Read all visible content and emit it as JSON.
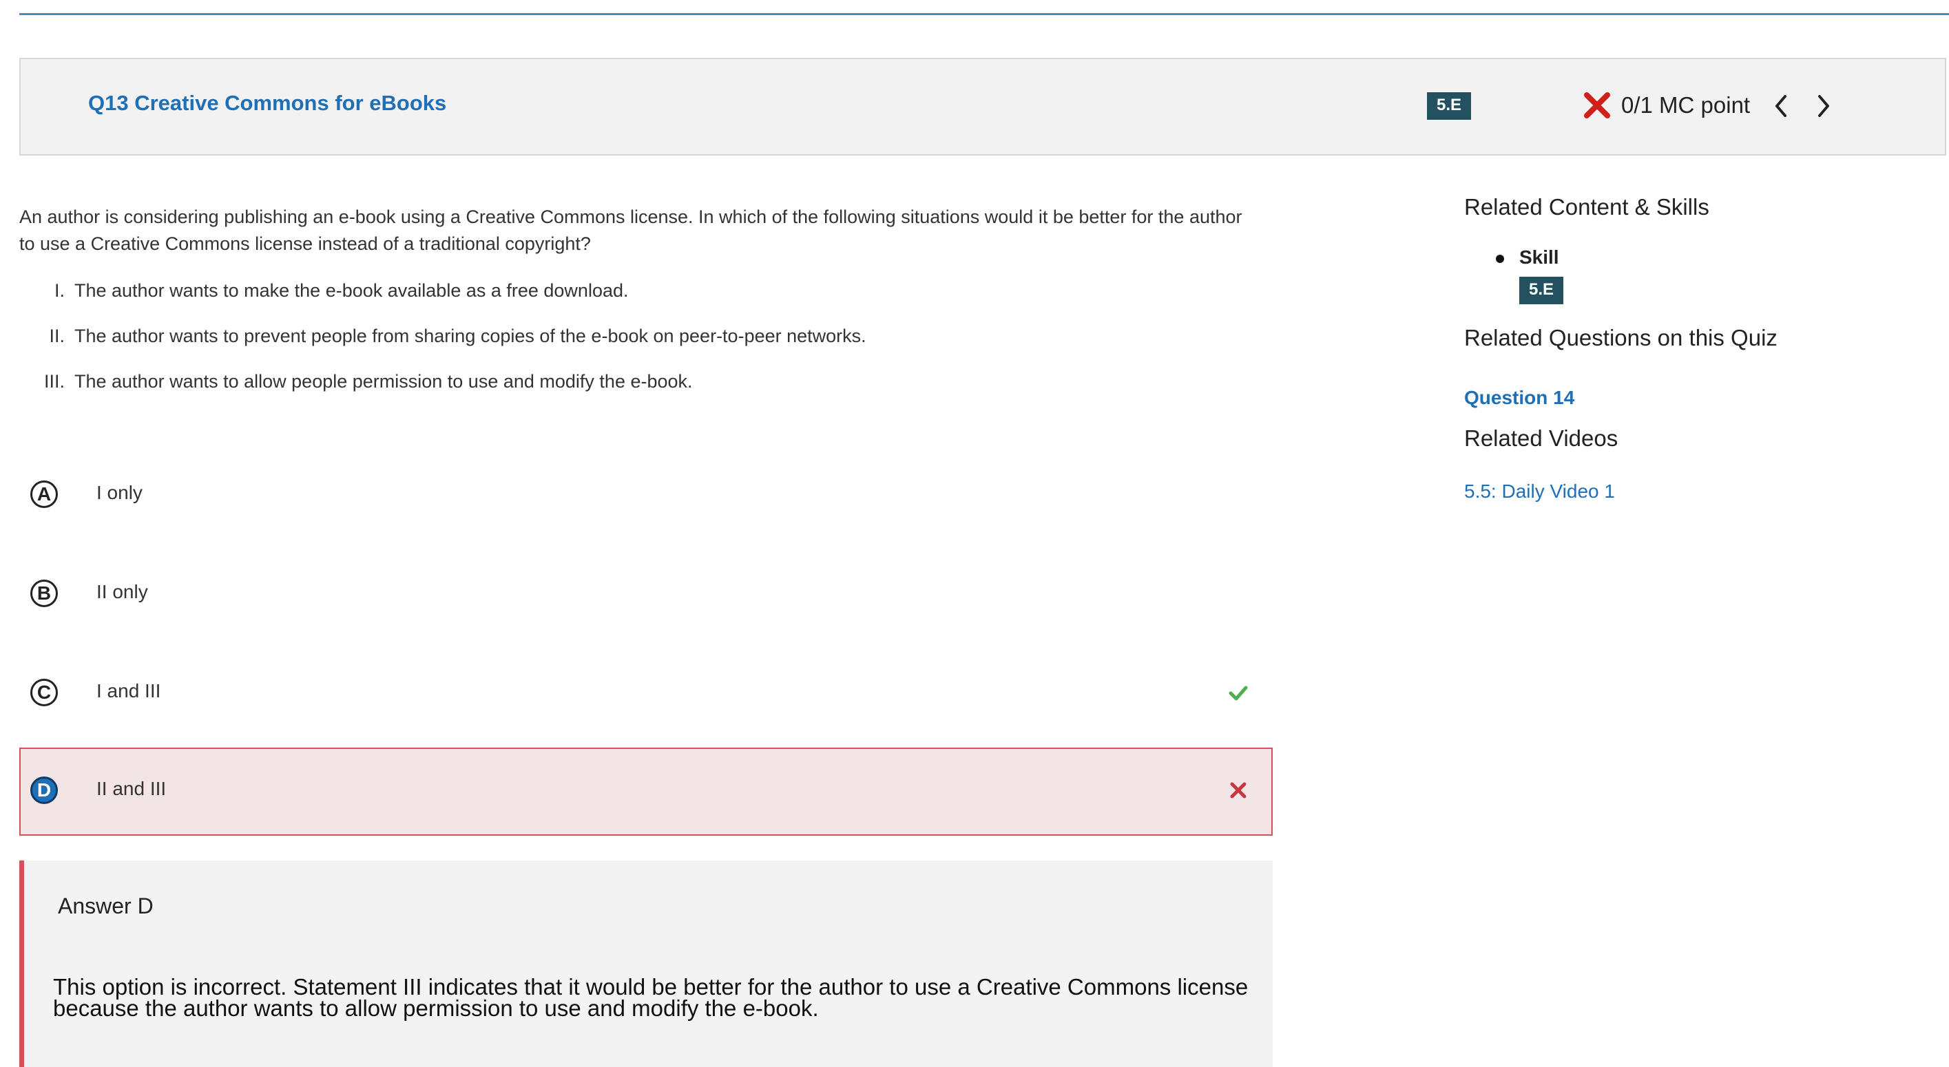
{
  "question": {
    "title": "Q13 Creative Commons for eBooks",
    "skill_badge": "5.E",
    "score": "0/1 MC point",
    "prev_icon": "chevron-left-icon",
    "next_icon": "chevron-right-icon",
    "score_icon": "incorrect-x-icon",
    "text": "An author is considering publishing an e-book using a Creative Commons license. In which of the following situations would it be better for the author to use a Creative Commons license instead of a traditional copyright?",
    "statements": [
      {
        "num": "I.",
        "text": "The author wants to make the e-book available as a free download."
      },
      {
        "num": "II.",
        "text": "The author wants to prevent people from sharing copies of the e-book on peer-to-peer networks."
      },
      {
        "num": "III.",
        "text": "The author wants to allow people permission to use and modify the e-book."
      }
    ]
  },
  "choices": [
    {
      "letter": "A",
      "text": "I only",
      "state": "none"
    },
    {
      "letter": "B",
      "text": "II only",
      "state": "none"
    },
    {
      "letter": "C",
      "text": "I and III",
      "state": "correct"
    },
    {
      "letter": "D",
      "text": "II and III",
      "state": "selected-incorrect"
    }
  ],
  "feedback": {
    "title": "Answer D",
    "body": "This option is incorrect. Statement III indicates that it would be better for the author to use a Creative Commons license because the author wants to allow permission to use and modify the e-book."
  },
  "sidebar": {
    "related_content_heading": "Related Content & Skills",
    "skill_label": "Skill",
    "skill_badge": "5.E",
    "related_questions_heading": "Related Questions on this Quiz",
    "related_question_link": "Question 14",
    "related_videos_heading": "Related Videos",
    "related_video_link": "5.5: Daily Video 1"
  },
  "colors": {
    "accent_blue": "#1f6fb6",
    "badge": "#24515f",
    "incorrect_red": "#d25257",
    "correct_green": "#4caf50"
  }
}
